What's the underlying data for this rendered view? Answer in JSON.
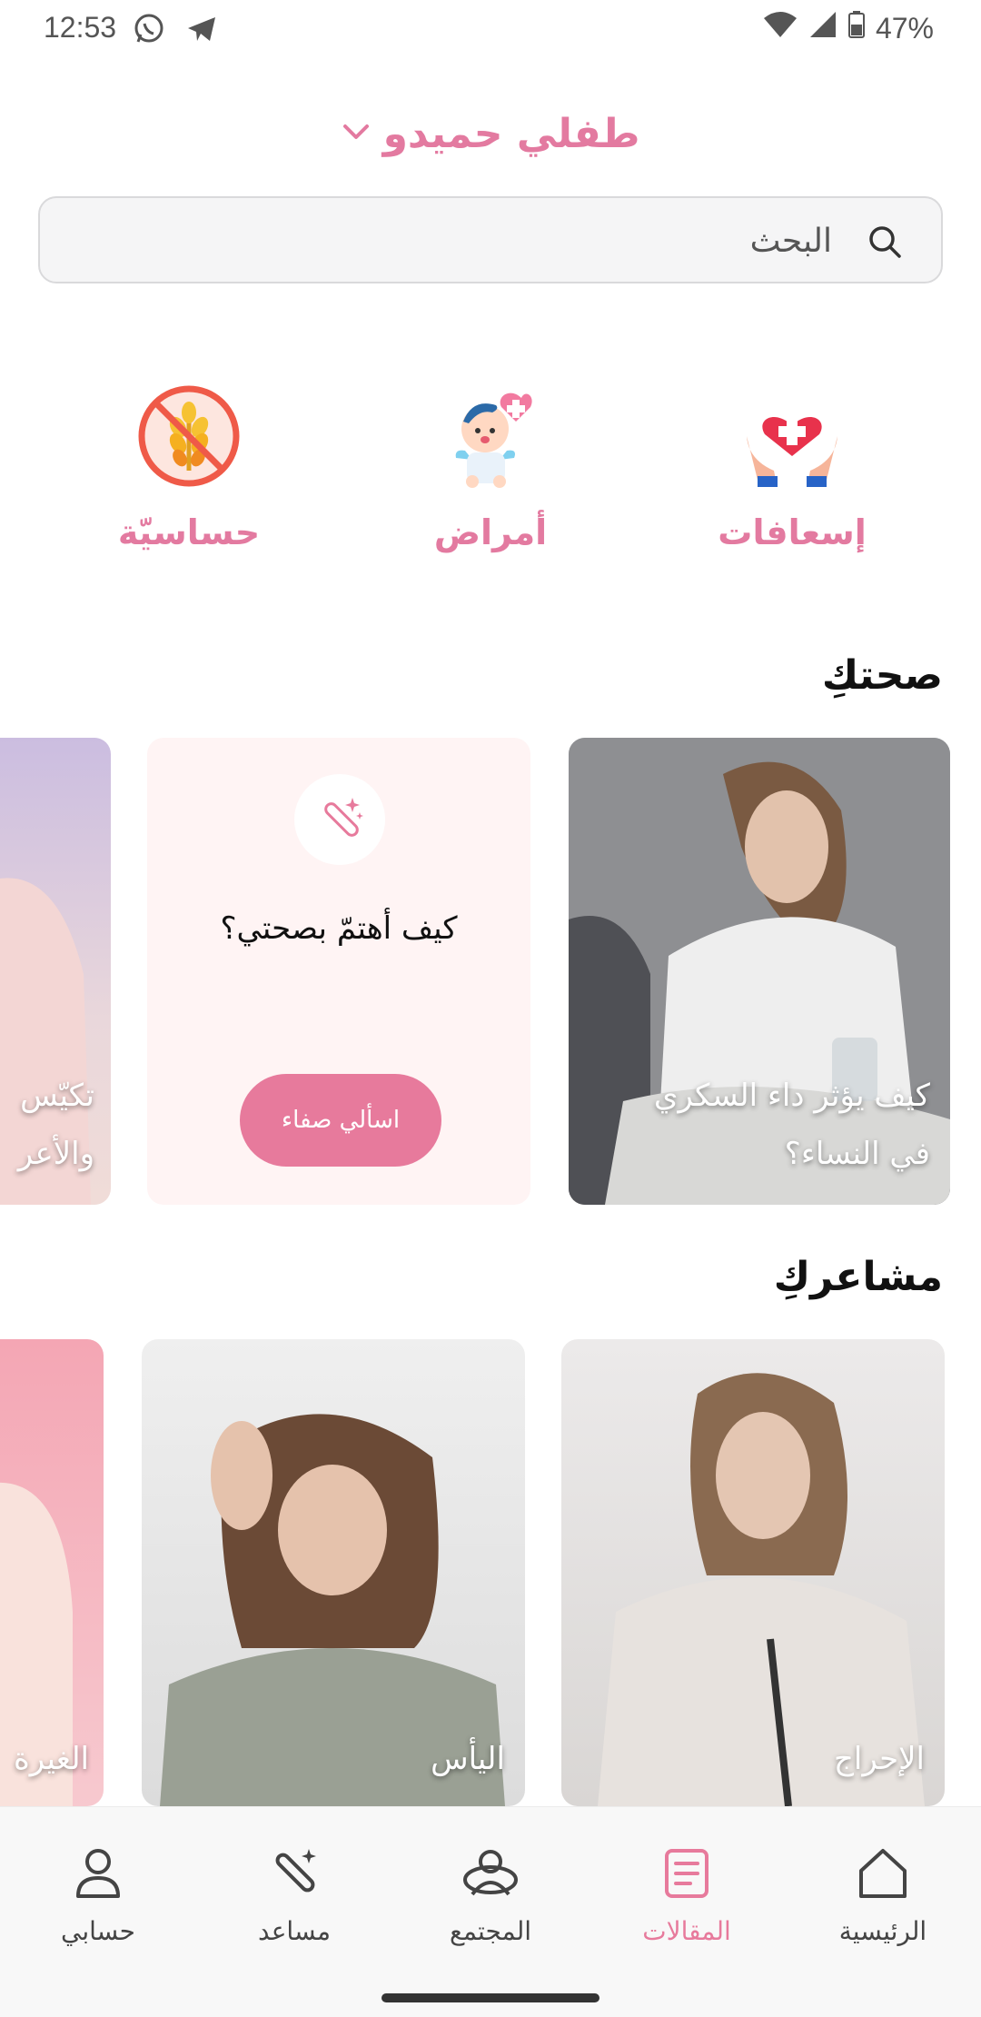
{
  "status_bar": {
    "time": "12:53",
    "battery": "47%",
    "app_icons": [
      "whatsapp-icon",
      "telegram-icon"
    ],
    "right_icons": [
      "wifi-icon",
      "signal-icon",
      "battery-icon"
    ]
  },
  "header": {
    "title": "طفلي حميدو",
    "dropdown_icon": "chevron-down-icon"
  },
  "search": {
    "placeholder": "البحث",
    "icon": "search-icon"
  },
  "categories": [
    {
      "label": "إسعافات",
      "icon": "first-aid-hands-icon"
    },
    {
      "label": "أمراض",
      "icon": "baby-illness-icon"
    },
    {
      "label": "حساسيّة",
      "icon": "allergy-icon"
    }
  ],
  "section_health": {
    "title": "صحتكِ",
    "cards": [
      {
        "caption_line1": "كيف يؤثر داء السكري",
        "caption_line2": "في النساء؟"
      },
      {
        "question": "كيف أهتمّ بصحتي؟",
        "button_label": "اسألي صفاء",
        "icon": "magic-wand-icon"
      },
      {
        "caption_line1": "تكيّس",
        "caption_line2": "والأعر"
      }
    ]
  },
  "section_feelings": {
    "title": "مشاعركِ",
    "cards": [
      {
        "caption": "الإحراج"
      },
      {
        "caption": "اليأس"
      },
      {
        "caption": "الغيرة"
      }
    ]
  },
  "bottom_nav": {
    "items": [
      {
        "label": "الرئيسية",
        "icon": "home-icon",
        "active": false
      },
      {
        "label": "المقالات",
        "icon": "articles-icon",
        "active": true
      },
      {
        "label": "المجتمع",
        "icon": "community-icon",
        "active": false
      },
      {
        "label": "مساعد",
        "icon": "assistant-wand-icon",
        "active": false
      },
      {
        "label": "حسابي",
        "icon": "profile-icon",
        "active": false
      }
    ]
  },
  "colors": {
    "accent": "#e77a9c",
    "promo_bg": "#fff4f4",
    "nav_bg": "#f8f8f8"
  }
}
